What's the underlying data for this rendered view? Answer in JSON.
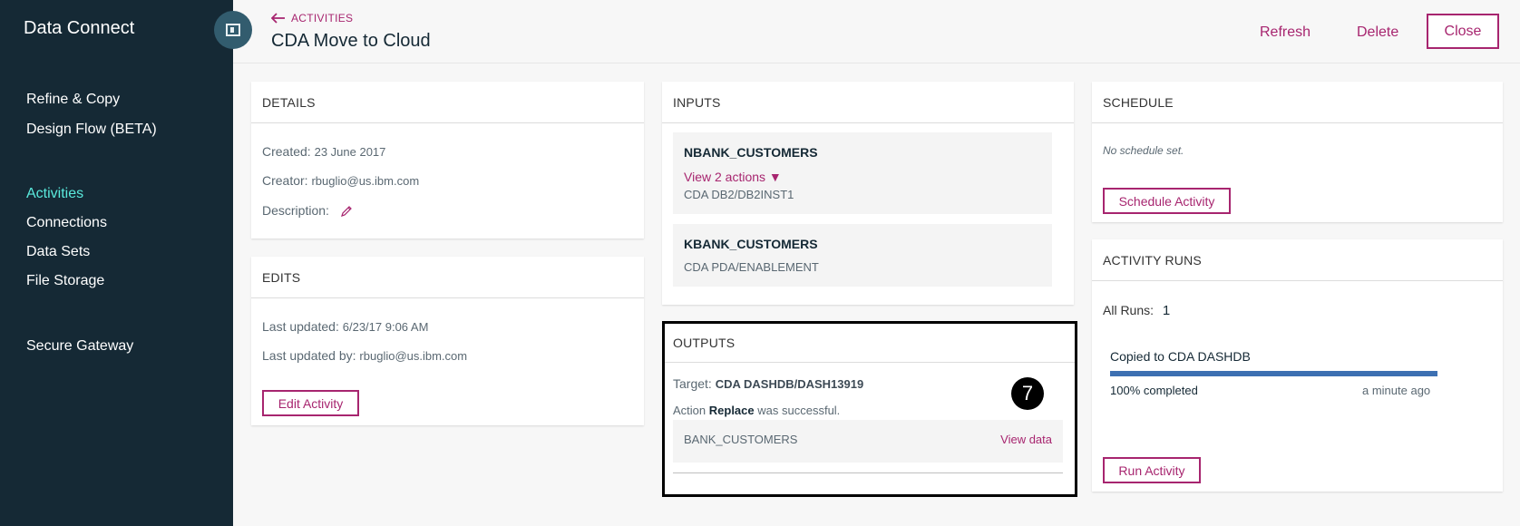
{
  "sidebar": {
    "app_title": "Data Connect",
    "items": [
      {
        "label": "Refine & Copy"
      },
      {
        "label": "Design Flow (BETA)"
      },
      {
        "label": "Activities",
        "active": true
      },
      {
        "label": "Connections"
      },
      {
        "label": "Data Sets"
      },
      {
        "label": "File Storage"
      },
      {
        "label": "Secure Gateway"
      }
    ]
  },
  "header": {
    "back_label": "ACTIVITIES",
    "title": "CDA Move to Cloud",
    "refresh_label": "Refresh",
    "delete_label": "Delete",
    "close_label": "Close"
  },
  "details": {
    "title": "DETAILS",
    "created_label": "Created:",
    "created_value": "23 June 2017",
    "creator_label": "Creator:",
    "creator_value": "rbuglio@us.ibm.com",
    "description_label": "Description:",
    "edit_icon": "pencil-icon"
  },
  "edits": {
    "title": "EDITS",
    "last_updated_label": "Last updated:",
    "last_updated_value": "6/23/17 9:06 AM",
    "last_updated_by_label": "Last updated by:",
    "last_updated_by_value": "rbuglio@us.ibm.com",
    "edit_button": "Edit Activity"
  },
  "inputs": {
    "title": "INPUTS",
    "items": [
      {
        "name": "NBANK_CUSTOMERS",
        "action_link": "View 2 actions ▼",
        "source": "CDA DB2/DB2INST1"
      },
      {
        "name": "KBANK_CUSTOMERS",
        "source": "CDA PDA/ENABLEMENT"
      }
    ]
  },
  "outputs": {
    "title": "OUTPUTS",
    "target_label": "Target:",
    "target_value": "CDA DASHDB/DASH13919",
    "action_prefix": "Action",
    "action_name": "Replace",
    "action_suffix": "was successful.",
    "table_name": "BANK_CUSTOMERS",
    "view_data_label": "View data",
    "badge": "7"
  },
  "schedule": {
    "title": "SCHEDULE",
    "empty_text": "No schedule set.",
    "schedule_button": "Schedule Activity"
  },
  "activity_runs": {
    "title": "ACTIVITY RUNS",
    "all_runs_label": "All Runs:",
    "all_runs_value": "1",
    "run_title": "Copied to CDA DASHDB",
    "progress_percent": 100,
    "progress_text": "100% completed",
    "time_ago": "a minute ago",
    "run_button": "Run Activity"
  },
  "colors": {
    "sidebar_bg": "#152935",
    "accent": "#a7256f",
    "active_nav": "#5aeadd",
    "progress": "#3d70b2"
  }
}
